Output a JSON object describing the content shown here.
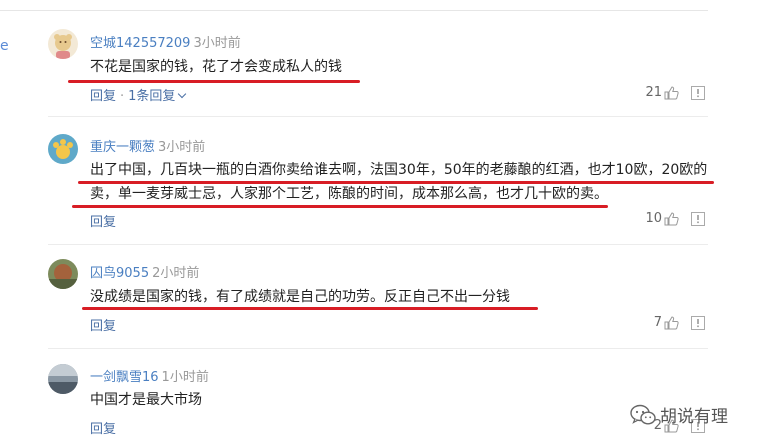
{
  "comments": [
    {
      "user": "空城142557209",
      "time": "3小时前",
      "lines": [
        "不花是国家的钱，花了才会变成私人的钱"
      ],
      "reply_label": "回复",
      "replies_label": "1条回复",
      "votes": "21"
    },
    {
      "user": "重庆一颗葱",
      "time": "3小时前",
      "lines": [
        "出了中国，几百块一瓶的白酒你卖给谁去啊，法国30年，50年的老藤酿的红酒，也才10欧，20欧的",
        "卖，单一麦芽威士忌，人家那个工艺，陈酿的时间，成本那么高，也才几十欧的卖。"
      ],
      "reply_label": "回复",
      "votes": "10"
    },
    {
      "user": "囚鸟9055",
      "time": "2小时前",
      "lines": [
        "没成绩是国家的钱，有了成绩就是自己的功劳。反正自己不出一分钱"
      ],
      "reply_label": "回复",
      "votes": "7"
    },
    {
      "user": "一剑飘雪16",
      "time": "1小时前",
      "lines": [
        "中国才是最大市场"
      ],
      "reply_label": "回复",
      "votes": "2"
    }
  ],
  "side_edge_text": "e",
  "watermark": {
    "text": "胡说有理",
    "icon": "wechat-icon"
  },
  "colors": {
    "username": "#4a7fc1",
    "annotation_line": "#d81d25",
    "link": "#4a6fa5"
  }
}
